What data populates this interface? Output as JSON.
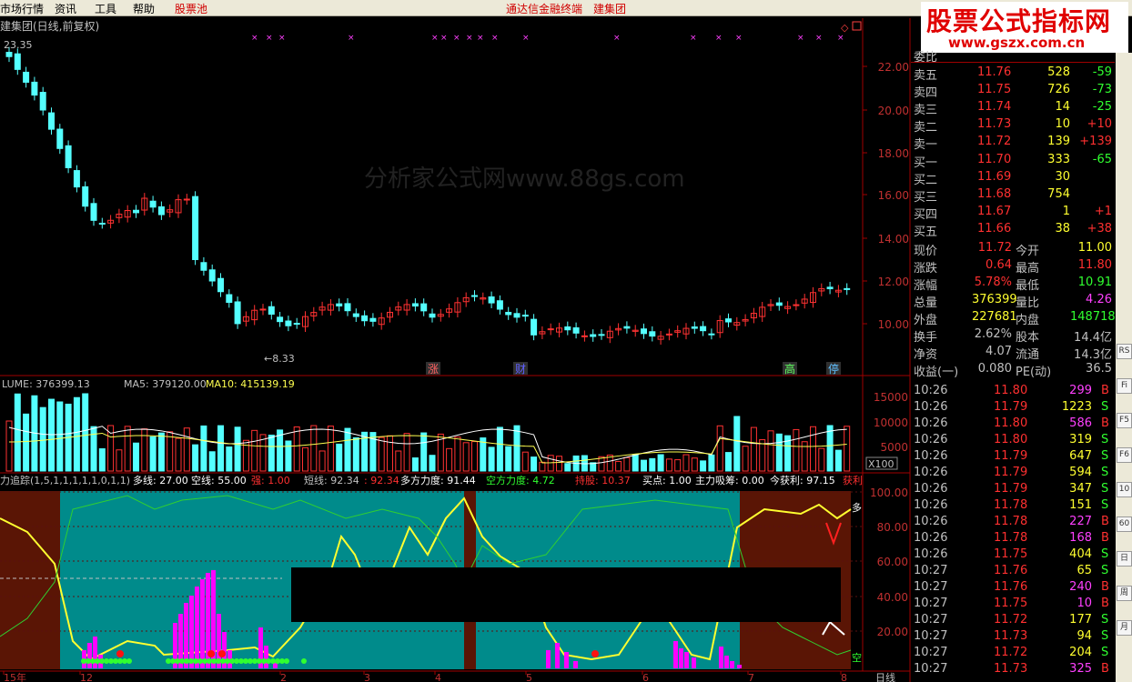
{
  "menu": {
    "items": [
      "市场行情",
      "资讯",
      "工具",
      "帮助"
    ],
    "stock_pool": "股票池",
    "center_links": [
      "通达信金融终端",
      "建集团"
    ]
  },
  "logo": {
    "line1": "股票公式指标网",
    "line2": "www.gszx.com.cn"
  },
  "chart": {
    "title": "建集团(日线,前复权)",
    "high_label": "23.35",
    "low_label": "8.33",
    "watermark": "分析家公式网www.88gs.com",
    "price_axis": [
      "22.00",
      "20.00",
      "18.00",
      "16.00",
      "14.00",
      "12.00",
      "10.00"
    ],
    "price_markers": [
      "涨",
      "财",
      "高",
      "停"
    ],
    "volume_header": {
      "name": "LUME: 376399.13",
      "ma5": "MA5: 379120.00",
      "ma10": "MA10: 415139.19"
    },
    "volume_axis": [
      "15000",
      "10000",
      "5000"
    ],
    "volume_unit": "X100",
    "indicator_header": {
      "params": "力追踪(1,5,1,1,1,1,1,0,1,1)",
      "duo": "多线: 27.00",
      "kong": "空线: 55.00",
      "red1": "强: 1.00",
      "short": "短线: 92.34",
      "short2": ": 92.34",
      "power_long": "多方力度: 91.44",
      "power_short": "空方力度: 4.72",
      "hold": "持股: 10.37",
      "buy": "买点: 1.00",
      "main": "主力吸筹: 0.00",
      "profit": "今获利: 97.15",
      "profit_tag": "获利"
    },
    "indicator_axis": [
      "100.00",
      "80.00",
      "60.00",
      "40.00",
      "20.00"
    ],
    "indicator_marks": [
      "多",
      "空"
    ],
    "x_axis": [
      "15年",
      "12",
      "2",
      "3",
      "4",
      "5",
      "6",
      "7",
      "8"
    ],
    "period": "日线"
  },
  "quote": {
    "header": "委比",
    "sells": [
      {
        "label": "卖五",
        "price": "11.76",
        "vol": "528",
        "chg": "-59"
      },
      {
        "label": "卖四",
        "price": "11.75",
        "vol": "726",
        "chg": "-73"
      },
      {
        "label": "卖三",
        "price": "11.74",
        "vol": "14",
        "chg": "-25"
      },
      {
        "label": "卖二",
        "price": "11.73",
        "vol": "10",
        "chg": "+10"
      },
      {
        "label": "卖一",
        "price": "11.72",
        "vol": "139",
        "chg": "+139"
      }
    ],
    "buys": [
      {
        "label": "买一",
        "price": "11.70",
        "vol": "333",
        "chg": "-65"
      },
      {
        "label": "买二",
        "price": "11.69",
        "vol": "30",
        "chg": ""
      },
      {
        "label": "买三",
        "price": "11.68",
        "vol": "754",
        "chg": ""
      },
      {
        "label": "买四",
        "price": "11.67",
        "vol": "1",
        "chg": "+1"
      },
      {
        "label": "买五",
        "price": "11.66",
        "vol": "38",
        "chg": "+38"
      }
    ],
    "stats": [
      {
        "l1": "现价",
        "v1": "11.72",
        "l2": "今开",
        "v2": "11.00"
      },
      {
        "l1": "涨跌",
        "v1": "0.64",
        "l2": "最高",
        "v2": "11.80"
      },
      {
        "l1": "涨幅",
        "v1": "5.78%",
        "l2": "最低",
        "v2": "10.91"
      },
      {
        "l1": "总量",
        "v1": "376399",
        "l2": "量比",
        "v2": "4.26"
      },
      {
        "l1": "外盘",
        "v1": "227681",
        "l2": "内盘",
        "v2": "148718"
      },
      {
        "l1": "换手",
        "v1": "2.62%",
        "l2": "股本",
        "v2": "14.4亿"
      },
      {
        "l1": "净资",
        "v1": "4.07",
        "l2": "流通",
        "v2": "14.3亿"
      },
      {
        "l1": "收益(一)",
        "v1": "0.080",
        "l2": "PE(动)",
        "v2": "36.5"
      }
    ],
    "ticks": [
      [
        "10:26",
        "11.80",
        "299",
        "B"
      ],
      [
        "10:26",
        "11.79",
        "1223",
        "S"
      ],
      [
        "10:26",
        "11.80",
        "586",
        "B"
      ],
      [
        "10:26",
        "11.80",
        "319",
        "S"
      ],
      [
        "10:26",
        "11.79",
        "647",
        "S"
      ],
      [
        "10:26",
        "11.79",
        "594",
        "S"
      ],
      [
        "10:26",
        "11.79",
        "347",
        "S"
      ],
      [
        "10:26",
        "11.78",
        "151",
        "S"
      ],
      [
        "10:26",
        "11.78",
        "227",
        "B"
      ],
      [
        "10:26",
        "11.78",
        "168",
        "B"
      ],
      [
        "10:26",
        "11.75",
        "404",
        "S"
      ],
      [
        "10:27",
        "11.76",
        "65",
        "S"
      ],
      [
        "10:27",
        "11.76",
        "240",
        "B"
      ],
      [
        "10:27",
        "11.75",
        "10",
        "B"
      ],
      [
        "10:27",
        "11.72",
        "177",
        "S"
      ],
      [
        "10:27",
        "11.73",
        "94",
        "S"
      ],
      [
        "10:27",
        "11.72",
        "204",
        "S"
      ],
      [
        "10:27",
        "11.73",
        "325",
        "B"
      ]
    ]
  },
  "toolbar": [
    "RS",
    "Fi",
    "F5",
    "F6",
    "10",
    "60",
    "日",
    "周",
    "月"
  ]
}
